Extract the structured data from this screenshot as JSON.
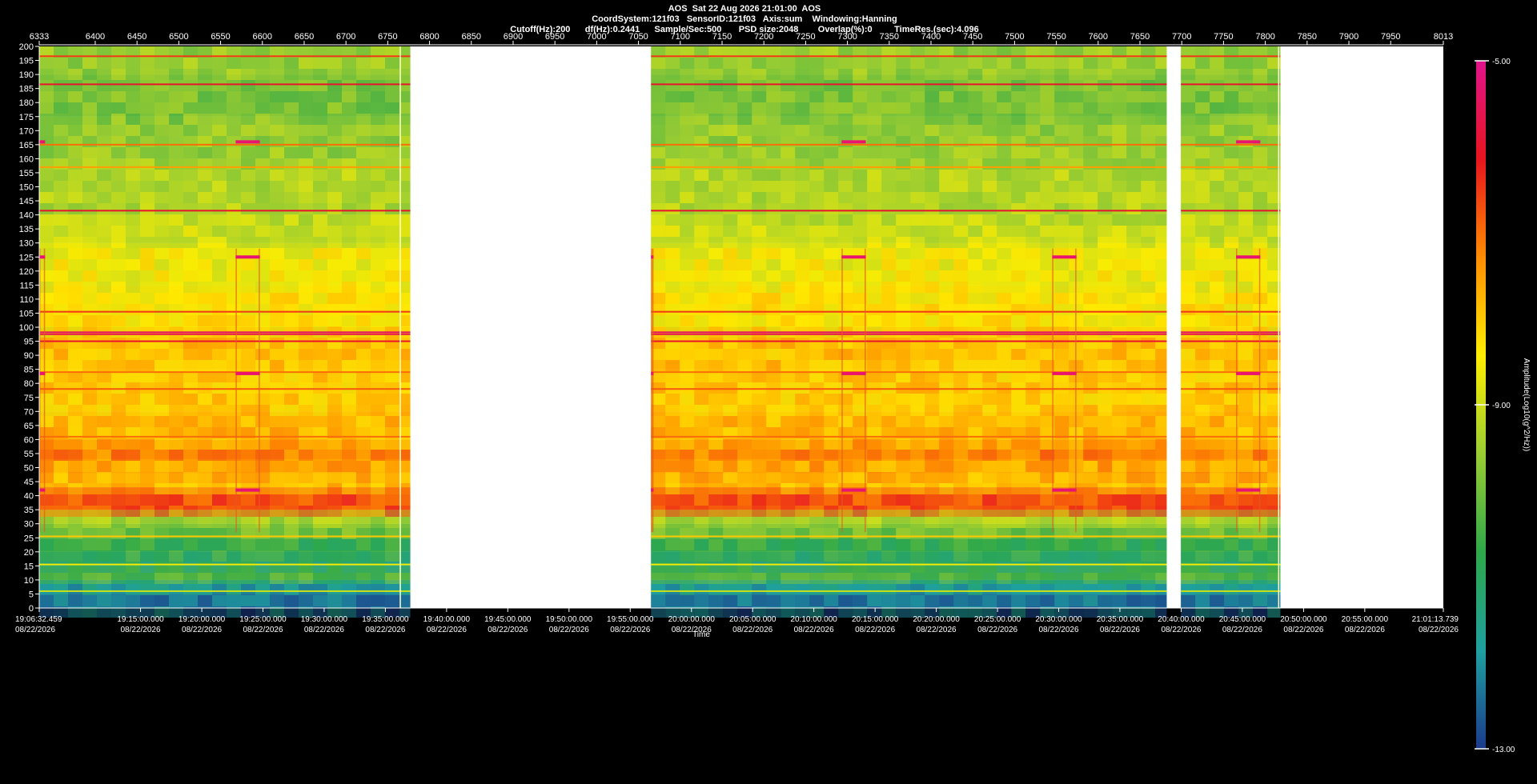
{
  "header": {
    "line1": "AOS  Sat 22 Aug 2026 21:01:00  AOS",
    "line2": "CoordSystem:121f03   SensorID:121f03   Axis:sum    Windowing:Hanning",
    "line3": "Cutoff(Hz):200      df(Hz):0.2441      Sample/Sec:500       PSD size:2048        Overlap(%):0         TimeRes.(sec):4.096"
  },
  "chart_data": {
    "type": "heatmap",
    "title": "AOS  Sat 22 Aug 2026 21:01:00  AOS",
    "xlabel": "Time",
    "ylabel": "",
    "colorbar_label": "Amplitude(Log10(g^2/Hz))",
    "color_range": [
      -13.0,
      -5.0
    ],
    "colorbar_ticks": [
      "-5.00",
      "-9.00",
      "-13.00"
    ],
    "colormap": [
      "#1b3a8c",
      "#1ea0a0",
      "#2ea84a",
      "#9acd32",
      "#ffee00",
      "#ff8c00",
      "#e8141e",
      "#e0148c"
    ],
    "ylim": [
      0,
      200
    ],
    "y_ticks": [
      0,
      5,
      10,
      15,
      20,
      25,
      30,
      35,
      40,
      45,
      50,
      55,
      60,
      65,
      70,
      75,
      80,
      85,
      90,
      95,
      100,
      105,
      110,
      115,
      120,
      125,
      130,
      135,
      140,
      145,
      150,
      155,
      160,
      165,
      170,
      175,
      180,
      185,
      190,
      195,
      200
    ],
    "top_axis": {
      "range": [
        6333,
        8013
      ],
      "ticks": [
        6333,
        6400,
        6450,
        6500,
        6550,
        6600,
        6650,
        6700,
        6750,
        6800,
        6850,
        6900,
        6950,
        7000,
        7050,
        7100,
        7150,
        7200,
        7250,
        7300,
        7350,
        7400,
        7450,
        7500,
        7550,
        7600,
        7650,
        7700,
        7750,
        7800,
        7850,
        7900,
        7950,
        8013
      ]
    },
    "x_ticks": [
      {
        "index": 6333,
        "time": "19:06:32.459",
        "date": "08/22/2026"
      },
      {
        "index": 6454.2,
        "time": "19:15:00.000",
        "date": "08/22/2026"
      },
      {
        "index": 6527.5,
        "time": "19:20:00.000",
        "date": "08/22/2026"
      },
      {
        "index": 6600.7,
        "time": "19:25:00.000",
        "date": "08/22/2026"
      },
      {
        "index": 6673.9,
        "time": "19:30:00.000",
        "date": "08/22/2026"
      },
      {
        "index": 6747.2,
        "time": "19:35:00.000",
        "date": "08/22/2026"
      },
      {
        "index": 6820.4,
        "time": "19:40:00.000",
        "date": "08/22/2026"
      },
      {
        "index": 6893.6,
        "time": "19:45:00.000",
        "date": "08/22/2026"
      },
      {
        "index": 6966.9,
        "time": "19:50:00.000",
        "date": "08/22/2026"
      },
      {
        "index": 7040.1,
        "time": "19:55:00.000",
        "date": "08/22/2026"
      },
      {
        "index": 7113.4,
        "time": "20:00:00.000",
        "date": "08/22/2026"
      },
      {
        "index": 7186.6,
        "time": "20:05:00.000",
        "date": "08/22/2026"
      },
      {
        "index": 7259.8,
        "time": "20:10:00.000",
        "date": "08/22/2026"
      },
      {
        "index": 7333.1,
        "time": "20:15:00.000",
        "date": "08/22/2026"
      },
      {
        "index": 7406.3,
        "time": "20:20:00.000",
        "date": "08/22/2026"
      },
      {
        "index": 7479.6,
        "time": "20:25:00.000",
        "date": "08/22/2026"
      },
      {
        "index": 7552.8,
        "time": "20:30:00.000",
        "date": "08/22/2026"
      },
      {
        "index": 7626.0,
        "time": "20:35:00.000",
        "date": "08/22/2026"
      },
      {
        "index": 7699.3,
        "time": "20:40:00.000",
        "date": "08/22/2026"
      },
      {
        "index": 7772.5,
        "time": "20:45:00.000",
        "date": "08/22/2026"
      },
      {
        "index": 7845.8,
        "time": "20:50:00.000",
        "date": "08/22/2026"
      },
      {
        "index": 7919.0,
        "time": "20:55:00.000",
        "date": "08/22/2026"
      },
      {
        "index": 8013,
        "time": "21:01:13.739",
        "date": "08/22/2026"
      }
    ],
    "data_segments": [
      {
        "start": 6333,
        "end": 6777
      },
      {
        "start": 7065,
        "end": 7682
      },
      {
        "start": 7699,
        "end": 7818
      }
    ],
    "vertical_markers": [
      {
        "at": 6765,
        "color": "#ffffcc"
      },
      {
        "at": 7816,
        "color": "#ffffcc"
      }
    ],
    "frequency_bands": [
      {
        "lo": 0,
        "hi": 5,
        "level": -12.3
      },
      {
        "lo": 5,
        "hi": 10,
        "level": -11.8
      },
      {
        "lo": 10,
        "hi": 15,
        "level": -10.4
      },
      {
        "lo": 15,
        "hi": 20,
        "level": -11.2
      },
      {
        "lo": 20,
        "hi": 25,
        "level": -10.7
      },
      {
        "lo": 25,
        "hi": 30,
        "level": -10.0
      },
      {
        "lo": 30,
        "hi": 35,
        "level": -9.4
      },
      {
        "lo": 35,
        "hi": 43,
        "level": -6.7
      },
      {
        "lo": 43,
        "hi": 48,
        "level": -7.9
      },
      {
        "lo": 48,
        "hi": 53,
        "level": -7.6
      },
      {
        "lo": 53,
        "hi": 60,
        "level": -7.2
      },
      {
        "lo": 60,
        "hi": 70,
        "level": -7.8
      },
      {
        "lo": 70,
        "hi": 85,
        "level": -8.0
      },
      {
        "lo": 85,
        "hi": 100,
        "level": -7.9
      },
      {
        "lo": 100,
        "hi": 115,
        "level": -8.3
      },
      {
        "lo": 115,
        "hi": 130,
        "level": -8.6
      },
      {
        "lo": 130,
        "hi": 140,
        "level": -9.0
      },
      {
        "lo": 140,
        "hi": 160,
        "level": -9.3
      },
      {
        "lo": 160,
        "hi": 175,
        "level": -9.6
      },
      {
        "lo": 175,
        "hi": 190,
        "level": -9.9
      },
      {
        "lo": 190,
        "hi": 200,
        "level": -9.6
      }
    ],
    "tone_lines": [
      {
        "hz": 196.5,
        "level": -6.5
      },
      {
        "hz": 186.5,
        "level": -6.0
      },
      {
        "hz": 165.0,
        "level": -7.0
      },
      {
        "hz": 157.0,
        "level": -7.5
      },
      {
        "hz": 141.5,
        "level": -6.0
      },
      {
        "hz": 105.5,
        "level": -6.5
      },
      {
        "hz": 98.2,
        "level": -5.4
      },
      {
        "hz": 97.5,
        "level": -5.6
      },
      {
        "hz": 95.0,
        "level": -6.0
      },
      {
        "hz": 84.0,
        "level": -7.0
      },
      {
        "hz": 78.0,
        "level": -6.8
      },
      {
        "hz": 61.0,
        "level": -7.0
      },
      {
        "hz": 25.5,
        "level": -8.0
      },
      {
        "hz": 15.5,
        "level": -8.5
      },
      {
        "hz": 6.0,
        "level": -9.0
      }
    ],
    "bursts": [
      {
        "start": 6333,
        "end": 6340,
        "tones": [
          166,
          125,
          83.5,
          42
        ]
      },
      {
        "start": 6568,
        "end": 6597,
        "tones": [
          166,
          125,
          83.5,
          42
        ]
      },
      {
        "start": 7065,
        "end": 7068,
        "tones": [
          125,
          83.5,
          42
        ]
      },
      {
        "start": 7293,
        "end": 7322,
        "tones": [
          166,
          125,
          83.5,
          42
        ]
      },
      {
        "start": 7545,
        "end": 7574,
        "tones": [
          125,
          83.5,
          42
        ]
      },
      {
        "start": 7765,
        "end": 7794,
        "tones": [
          166,
          125,
          83.5,
          42
        ]
      }
    ]
  }
}
